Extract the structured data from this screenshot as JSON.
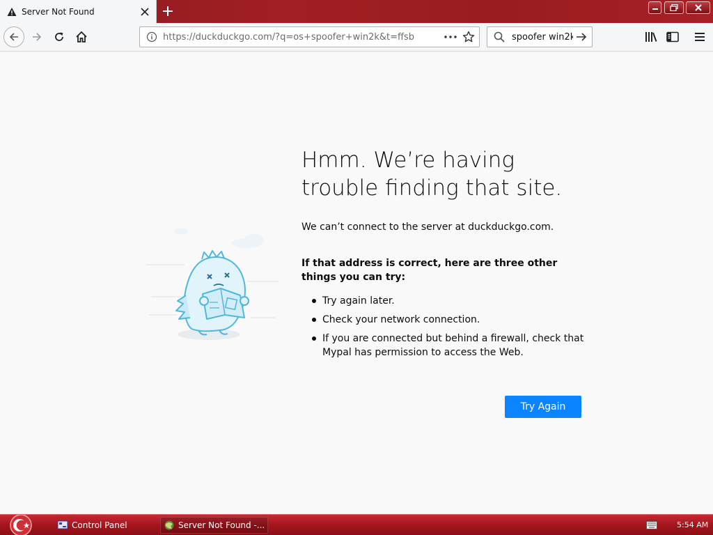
{
  "window": {
    "tab_title": "Server Not Found",
    "address_url": "https://duckduckgo.com/?q=os+spoofer+win2k&t=ffsb",
    "search_value": "spoofer win2k"
  },
  "page": {
    "title": "Hmm. We’re having trouble finding that site.",
    "description": "We can’t connect to the server at duckduckgo.com.",
    "tips_heading": "If that address is correct, here are three other things you can try:",
    "tips": [
      "Try again later.",
      "Check your network connection.",
      "If you are connected but behind a firewall, check that Mypal has permission to access the Web."
    ],
    "try_again_label": "Try Again"
  },
  "taskbar": {
    "items": [
      {
        "label": "Control Panel",
        "icon": "control-panel-icon"
      },
      {
        "label": "Server Not Found -...",
        "icon": "mypal-icon"
      }
    ],
    "clock": "5:54 AM"
  },
  "colors": {
    "accent": "#0a84ff",
    "titlebar": "#9a1c20",
    "taskbar": "#b31c24"
  }
}
